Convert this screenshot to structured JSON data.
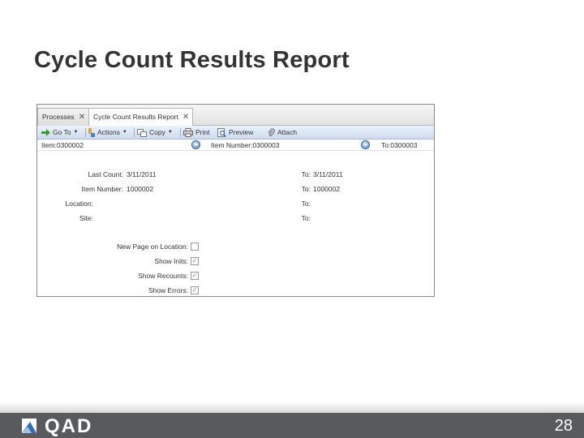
{
  "slide": {
    "title": "Cycle Count Results Report",
    "page_number": "28",
    "logo_text": "QAD"
  },
  "app": {
    "tabs": [
      {
        "label": "Processes",
        "active": false
      },
      {
        "label": "Cycle Count Results Report",
        "active": true
      }
    ],
    "toolbar": [
      {
        "label": "Go To",
        "icon": "go-arrow-icon",
        "dropdown": true
      },
      {
        "label": "Actions",
        "icon": "actions-icon",
        "dropdown": true
      },
      {
        "label": "Copy",
        "icon": "copy-icon",
        "dropdown": true
      },
      {
        "label": "Print",
        "icon": "printer-icon",
        "dropdown": false
      },
      {
        "label": "Preview",
        "icon": "preview-icon",
        "dropdown": false
      },
      {
        "label": "Attach",
        "icon": "paperclip-icon",
        "dropdown": false
      }
    ],
    "filter_bar": {
      "item": "Item:0300002",
      "item_number": "Item Number:0300003",
      "to": "To:0300003"
    },
    "form": {
      "last_count_label": "Last Count:",
      "last_count_value": "3/11/2011",
      "last_count_to_label": "To:",
      "last_count_to_value": "3/11/2011",
      "item_number_label": "Item Number:",
      "item_number_value": "1000002",
      "item_number_to_label": "To:",
      "item_number_to_value": "1000002",
      "location_label": "Location:",
      "location_to_label": "To:",
      "site_label": "Site:",
      "site_to_label": "To:",
      "options": [
        {
          "label": "New Page on Location:",
          "checked": false
        },
        {
          "label": "Show Inits:",
          "checked": true
        },
        {
          "label": "Show Recounts:",
          "checked": true
        },
        {
          "label": "Show Errors:",
          "checked": true
        }
      ]
    }
  },
  "colors": {
    "footer": "#585a5c",
    "toolbar": "#cfdcef"
  }
}
